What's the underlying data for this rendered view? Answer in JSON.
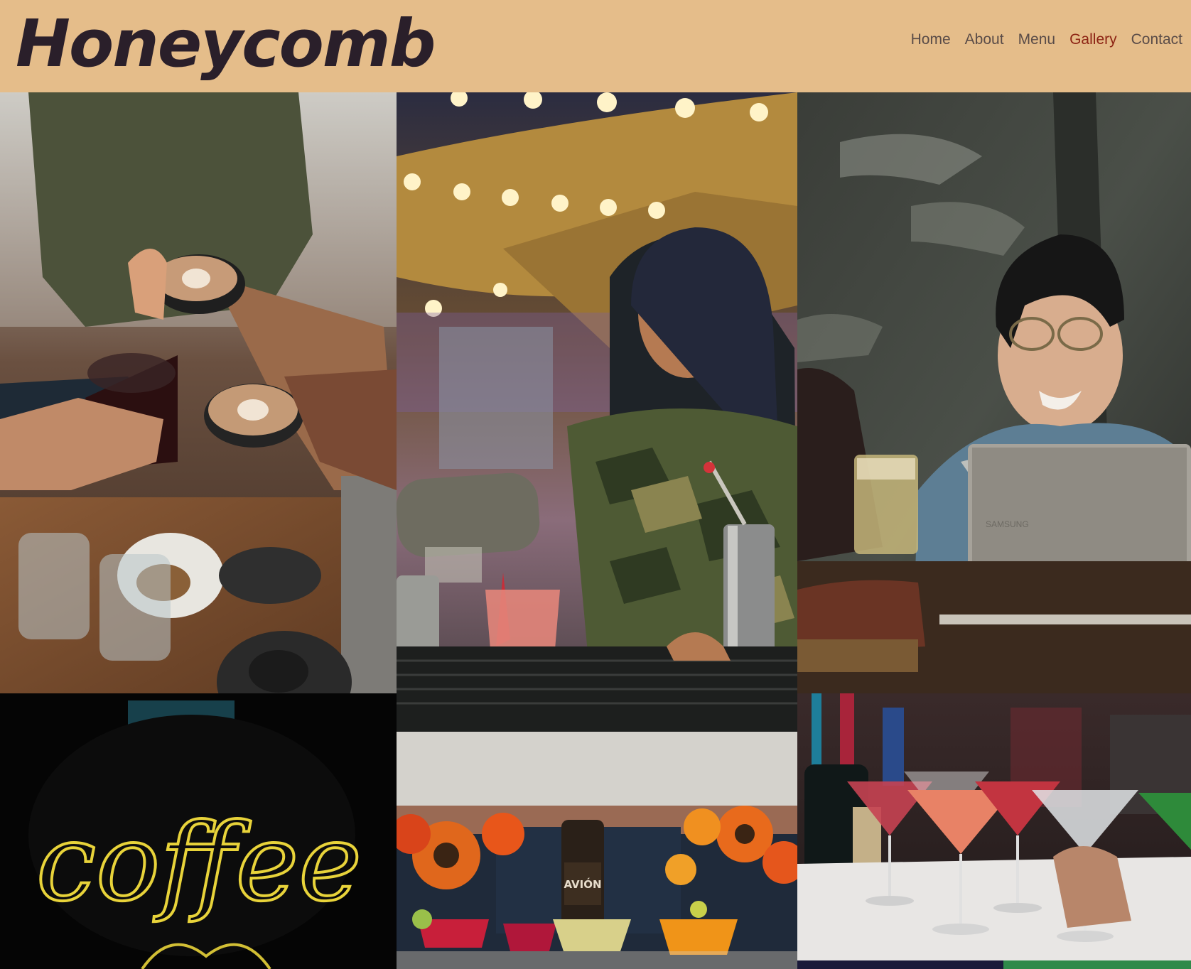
{
  "site": {
    "logo": "Honeycomb"
  },
  "nav": {
    "items": [
      {
        "label": "Home",
        "active": false
      },
      {
        "label": "About",
        "active": false
      },
      {
        "label": "Menu",
        "active": false
      },
      {
        "label": "Gallery",
        "active": true
      },
      {
        "label": "Contact",
        "active": false
      }
    ]
  },
  "colors": {
    "header_bg": "#e5bd8a",
    "logo": "#2a1f2a",
    "nav_text": "#5a4c48",
    "nav_active": "#8d2414",
    "neon": "#e8d33a"
  },
  "gallery": {
    "neon_sign_text": "coffee",
    "bottle_label": "AVIÓN"
  }
}
